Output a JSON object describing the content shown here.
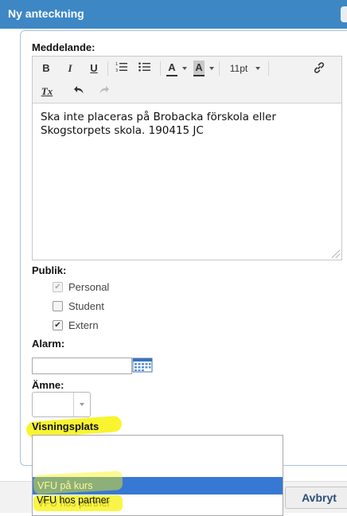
{
  "window": {
    "title": "Ny anteckning"
  },
  "message": {
    "label": "Meddelande:",
    "toolbar": {
      "bold": "B",
      "italic": "I",
      "underline": "U",
      "ordered_list_icon": "ordered-list-icon",
      "bullet_list_icon": "bullet-list-icon",
      "text_color": "A",
      "bg_color": "A",
      "font_size": "11pt",
      "link_icon": "link-icon",
      "clear_format": "Tx",
      "undo_icon": "undo-icon",
      "redo_icon": "redo-icon"
    },
    "text": "Ska inte placeras på Brobacka förskola eller Skogstorpets skola. 190415 JC"
  },
  "public": {
    "label": "Publik:",
    "options": [
      {
        "label": "Personal",
        "checked": true,
        "disabled": true
      },
      {
        "label": "Student",
        "checked": false,
        "disabled": false
      },
      {
        "label": "Extern",
        "checked": true,
        "disabled": false
      }
    ]
  },
  "alarm": {
    "label": "Alarm:",
    "value": "",
    "calendar_icon": "calendar-icon"
  },
  "subject": {
    "label": "Ämne:",
    "value": ""
  },
  "display_place": {
    "label": "Visningsplats",
    "options": [
      {
        "label": "VFU på kurs",
        "selected": true
      },
      {
        "label": "VFU hos partner",
        "selected": false
      }
    ]
  },
  "buttons": {
    "cancel": "Avbryt"
  },
  "colors": {
    "title_bar": "#3d87c5",
    "highlight": "#f7f20b",
    "selection": "#3778d4"
  }
}
